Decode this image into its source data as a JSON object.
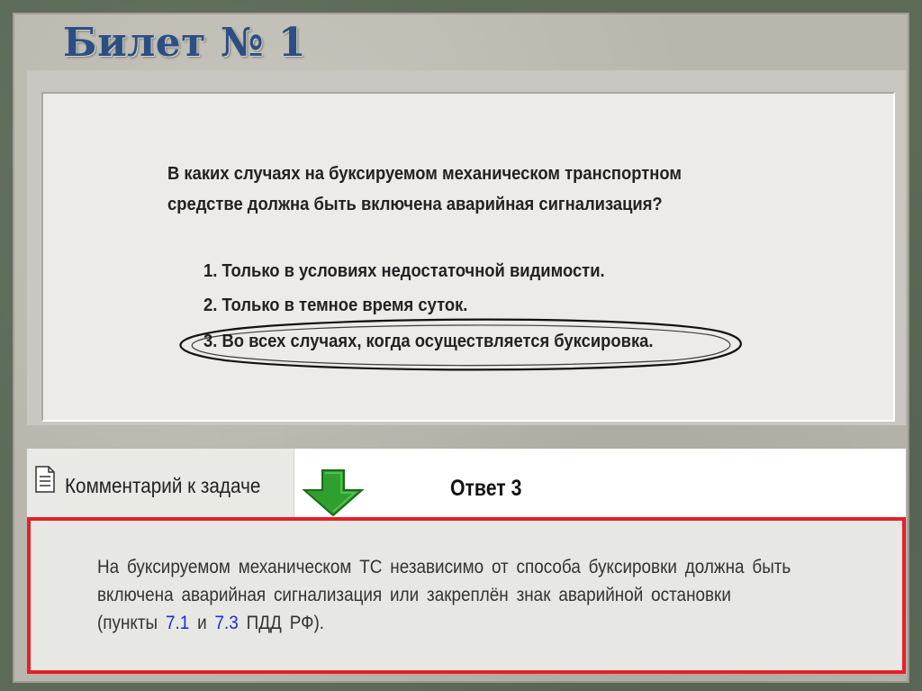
{
  "slide": {
    "title": "Билет № 1"
  },
  "question": {
    "line1": "В каких случаях на буксируемом механическом транспортном",
    "line2": "средстве должна быть включена аварийная сигнализация?",
    "options": [
      {
        "label": "1. Только в условиях недостаточной видимости."
      },
      {
        "label": "2. Только в темное время суток."
      },
      {
        "label": "3. Во всех случаях, когда осуществляется буксировка."
      }
    ],
    "highlighted_option": 3
  },
  "comment_bar": {
    "tab_label": "Комментарий к задаче",
    "tab_icon": "document-icon",
    "arrow_icon": "arrow-down-icon",
    "answer_label": "Ответ 3"
  },
  "explanation": {
    "text_part1": "На буксируемом механическом ТС независимо от способа буксировки должна быть включена аварийная сигнализация или закреплён знак аварийной остановки (пункты ",
    "link1": "7.1",
    "text_part2": " и ",
    "link2": "7.3",
    "text_part3": " ПДД РФ)."
  },
  "colors": {
    "title": "#2b4f82",
    "background": "#5d6a58",
    "slide": "#b9b7ad",
    "arrow": "#2ea02e",
    "box_border": "#e3202a",
    "link": "#1a2fd6"
  }
}
